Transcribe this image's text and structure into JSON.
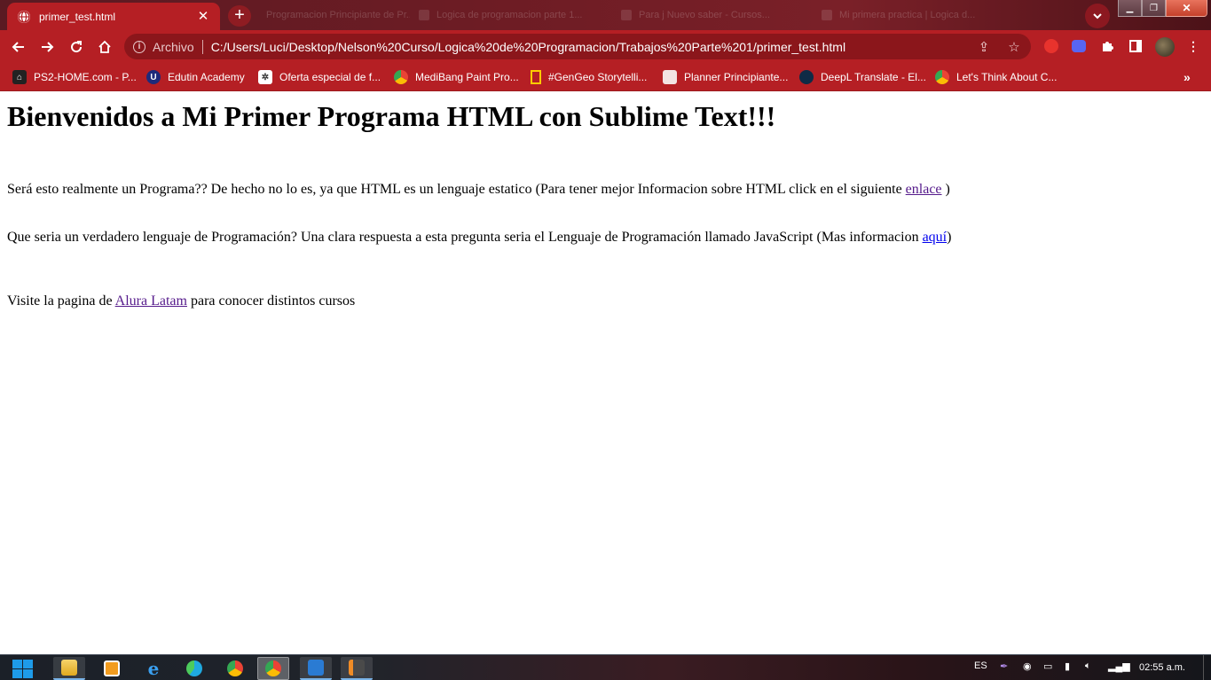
{
  "browser": {
    "active_tab": {
      "title": "primer_test.html"
    },
    "background_tabs": [
      {
        "title": "Programacion Principiante de Pr..."
      },
      {
        "title": "Logica de programacion parte 1..."
      },
      {
        "title": "Para j Nuevo saber - Cursos..."
      },
      {
        "title": "Mi primera practica | Logica d..."
      }
    ],
    "omnibox": {
      "scheme_label": "Archivo",
      "url": "C:/Users/Luci/Desktop/Nelson%20Curso/Logica%20de%20Programacion/Trabajos%20Parte%201/primer_test.html"
    },
    "bookmarks": [
      {
        "label": "PS2-HOME.com - P...",
        "icon": "ps2-icon"
      },
      {
        "label": "Edutin Academy",
        "icon": "edutin-icon"
      },
      {
        "label": "Oferta especial de f...",
        "icon": "sena-icon"
      },
      {
        "label": "MediBang Paint Pro...",
        "icon": "chrome-icon"
      },
      {
        "label": "#GenGeo Storytelli...",
        "icon": "natgeo-icon"
      },
      {
        "label": "Planner Principiante...",
        "icon": "planner-icon"
      },
      {
        "label": "DeepL Translate - El...",
        "icon": "deepl-icon"
      },
      {
        "label": "Let's Think About C...",
        "icon": "chrome-icon"
      }
    ],
    "theme_color": "#b51f24"
  },
  "page": {
    "heading": "Bienvenidos a Mi Primer Programa HTML con Sublime Text!!!",
    "p1": {
      "text": "Será esto realmente un Programa?? De hecho no lo es, ya que HTML es un lenguaje estatico (Para tener mejor Informacion sobre HTML click en el siguiente ",
      "link": "enlace",
      "tail": " )"
    },
    "p2": {
      "text": "Que seria un verdadero lenguaje de Programación? Una clara respuesta a esta pregunta seria el Lenguaje de Programación llamado JavaScript (Mas informacion ",
      "link": "aquí",
      "tail": ")"
    },
    "p3": {
      "text": "Visite la pagina de ",
      "link": "Alura Latam",
      "tail": " para conocer distintos cursos"
    },
    "link_color": "#551a8b"
  },
  "taskbar": {
    "language": "ES",
    "time": "02:55 a.m.",
    "apps": [
      {
        "name": "file-explorer"
      },
      {
        "name": "media-player"
      },
      {
        "name": "internet-explorer"
      },
      {
        "name": "edge"
      },
      {
        "name": "chrome"
      },
      {
        "name": "chrome-active"
      },
      {
        "name": "vscode"
      },
      {
        "name": "sublime-text"
      }
    ]
  }
}
